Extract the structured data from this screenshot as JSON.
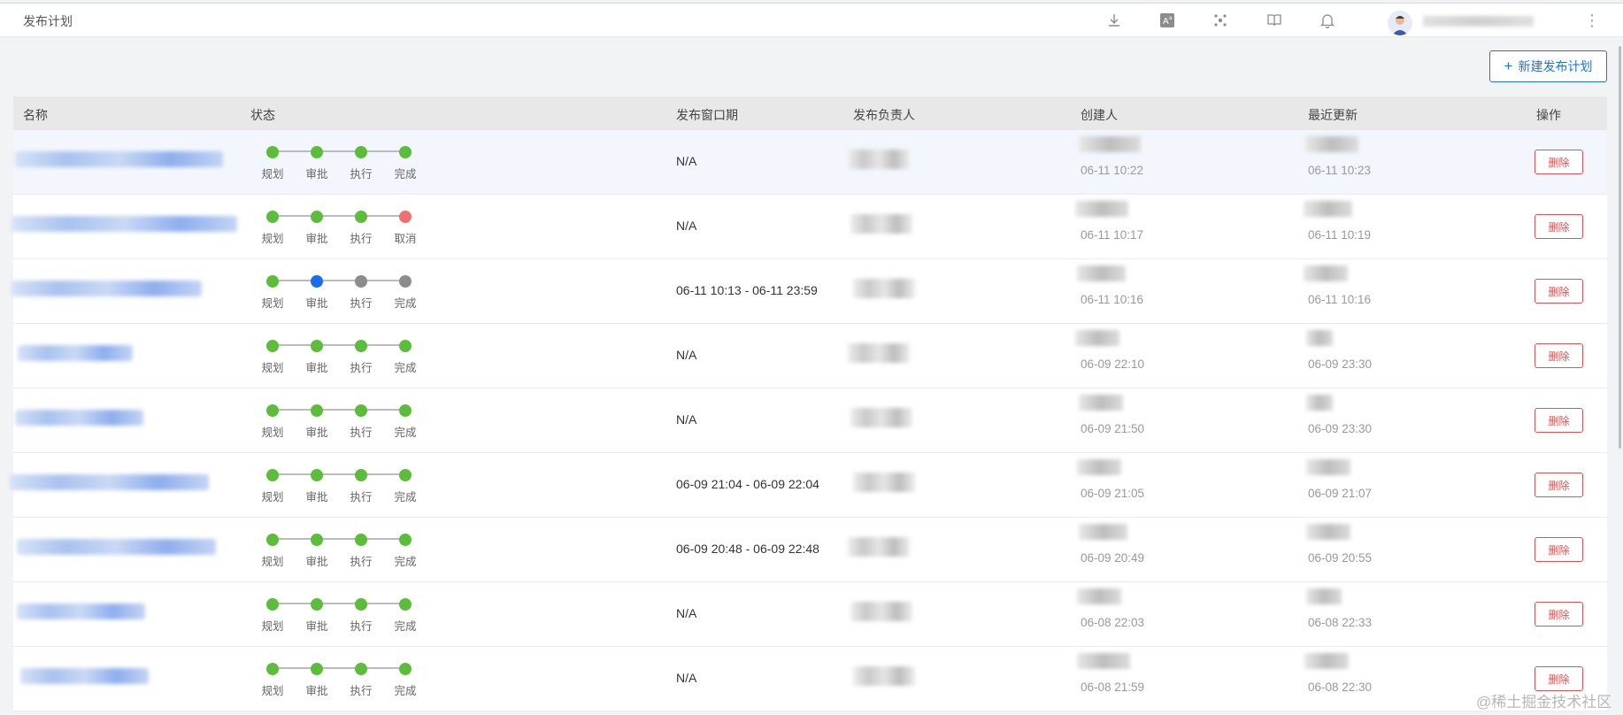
{
  "header": {
    "title": "发布计划",
    "icons": [
      "download-icon",
      "translate-icon",
      "apps-icon",
      "book-icon",
      "bell-icon"
    ]
  },
  "toolbar": {
    "new_label": "新建发布计划"
  },
  "table": {
    "columns": [
      "名称",
      "状态",
      "发布窗口期",
      "发布负责人",
      "创建人",
      "最近更新",
      "操作"
    ],
    "rows": [
      {
        "steps": [
          {
            "label": "规划",
            "status": "done"
          },
          {
            "label": "审批",
            "status": "done"
          },
          {
            "label": "执行",
            "status": "done"
          },
          {
            "label": "完成",
            "status": "done"
          }
        ],
        "window": "N/A",
        "created": "06-11 10:22",
        "updated": "06-11 10:23",
        "action": "删除"
      },
      {
        "steps": [
          {
            "label": "规划",
            "status": "done"
          },
          {
            "label": "审批",
            "status": "done"
          },
          {
            "label": "执行",
            "status": "done"
          },
          {
            "label": "取消",
            "status": "cancelled"
          }
        ],
        "window": "N/A",
        "created": "06-11 10:17",
        "updated": "06-11 10:19",
        "action": "删除"
      },
      {
        "steps": [
          {
            "label": "规划",
            "status": "done"
          },
          {
            "label": "审批",
            "status": "current"
          },
          {
            "label": "执行",
            "status": "pending"
          },
          {
            "label": "完成",
            "status": "pending"
          }
        ],
        "window": "06-11 10:13 - 06-11 23:59",
        "created": "06-11 10:16",
        "updated": "06-11 10:16",
        "action": "删除"
      },
      {
        "steps": [
          {
            "label": "规划",
            "status": "done"
          },
          {
            "label": "审批",
            "status": "done"
          },
          {
            "label": "执行",
            "status": "done"
          },
          {
            "label": "完成",
            "status": "done"
          }
        ],
        "window": "N/A",
        "created": "06-09 22:10",
        "updated": "06-09 23:30",
        "action": "删除"
      },
      {
        "steps": [
          {
            "label": "规划",
            "status": "done"
          },
          {
            "label": "审批",
            "status": "done"
          },
          {
            "label": "执行",
            "status": "done"
          },
          {
            "label": "完成",
            "status": "done"
          }
        ],
        "window": "N/A",
        "created": "06-09 21:50",
        "updated": "06-09 23:30",
        "action": "删除"
      },
      {
        "steps": [
          {
            "label": "规划",
            "status": "done"
          },
          {
            "label": "审批",
            "status": "done"
          },
          {
            "label": "执行",
            "status": "done"
          },
          {
            "label": "完成",
            "status": "done"
          }
        ],
        "window": "06-09 21:04 - 06-09 22:04",
        "created": "06-09 21:05",
        "updated": "06-09 21:07",
        "action": "删除"
      },
      {
        "steps": [
          {
            "label": "规划",
            "status": "done"
          },
          {
            "label": "审批",
            "status": "done"
          },
          {
            "label": "执行",
            "status": "done"
          },
          {
            "label": "完成",
            "status": "done"
          }
        ],
        "window": "06-09 20:48 - 06-09 22:48",
        "created": "06-09 20:49",
        "updated": "06-09 20:55",
        "action": "删除"
      },
      {
        "steps": [
          {
            "label": "规划",
            "status": "done"
          },
          {
            "label": "审批",
            "status": "done"
          },
          {
            "label": "执行",
            "status": "done"
          },
          {
            "label": "完成",
            "status": "done"
          }
        ],
        "window": "N/A",
        "created": "06-08 22:03",
        "updated": "06-08 22:33",
        "action": "删除"
      },
      {
        "steps": [
          {
            "label": "规划",
            "status": "done"
          },
          {
            "label": "审批",
            "status": "done"
          },
          {
            "label": "执行",
            "status": "done"
          },
          {
            "label": "完成",
            "status": "done"
          }
        ],
        "window": "N/A",
        "created": "06-08 21:59",
        "updated": "06-08 22:30",
        "action": "删除"
      }
    ]
  },
  "colors": {
    "done": "#5cbd3a",
    "current": "#1a6cf0",
    "pending": "#8c8c8c",
    "cancelled": "#f07070",
    "primary": "#1a73e8",
    "danger": "#e05252"
  },
  "watermark": "@稀土掘金技术社区"
}
